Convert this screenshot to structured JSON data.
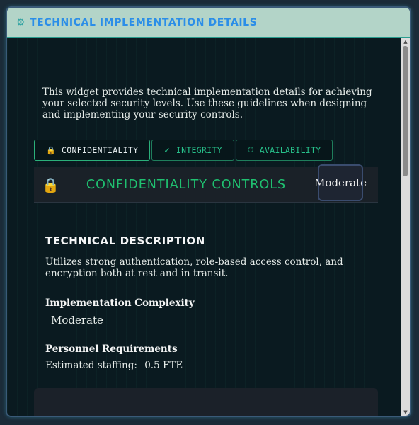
{
  "window": {
    "title": "TECHNICAL IMPLEMENTATION DETAILS",
    "title_icon": "gear-icon"
  },
  "intro_text": "This widget provides technical implementation details for achieving your selected security levels. Use these guidelines when designing and implementing your security controls.",
  "tabs": [
    {
      "label": "CONFIDENTIALITY",
      "icon": "lock-icon",
      "glyph": "🔒",
      "active": true
    },
    {
      "label": "INTEGRITY",
      "icon": "check-icon",
      "glyph": "✓",
      "active": false
    },
    {
      "label": "AVAILABILITY",
      "icon": "stopwatch-icon",
      "glyph": "⏱",
      "active": false
    }
  ],
  "section": {
    "title": "CONFIDENTIALITY CONTROLS",
    "icon": "lock-icon",
    "level": "Moderate"
  },
  "technical_description": {
    "heading": "TECHNICAL DESCRIPTION",
    "text": "Utilizes strong authentication, role-based access control, and encryption both at rest and in transit."
  },
  "implementation_complexity": {
    "heading": "Implementation Complexity",
    "value": "Moderate"
  },
  "personnel_requirements": {
    "heading": "Personnel Requirements",
    "label": "Estimated staffing:",
    "value": "0.5 FTE"
  },
  "colors": {
    "title_bar": "#b3d4c8",
    "title_text": "#2b8ee8",
    "accent_green": "#1fc070",
    "lock_gold": "#e5b40f",
    "background": "#0a1a20"
  }
}
